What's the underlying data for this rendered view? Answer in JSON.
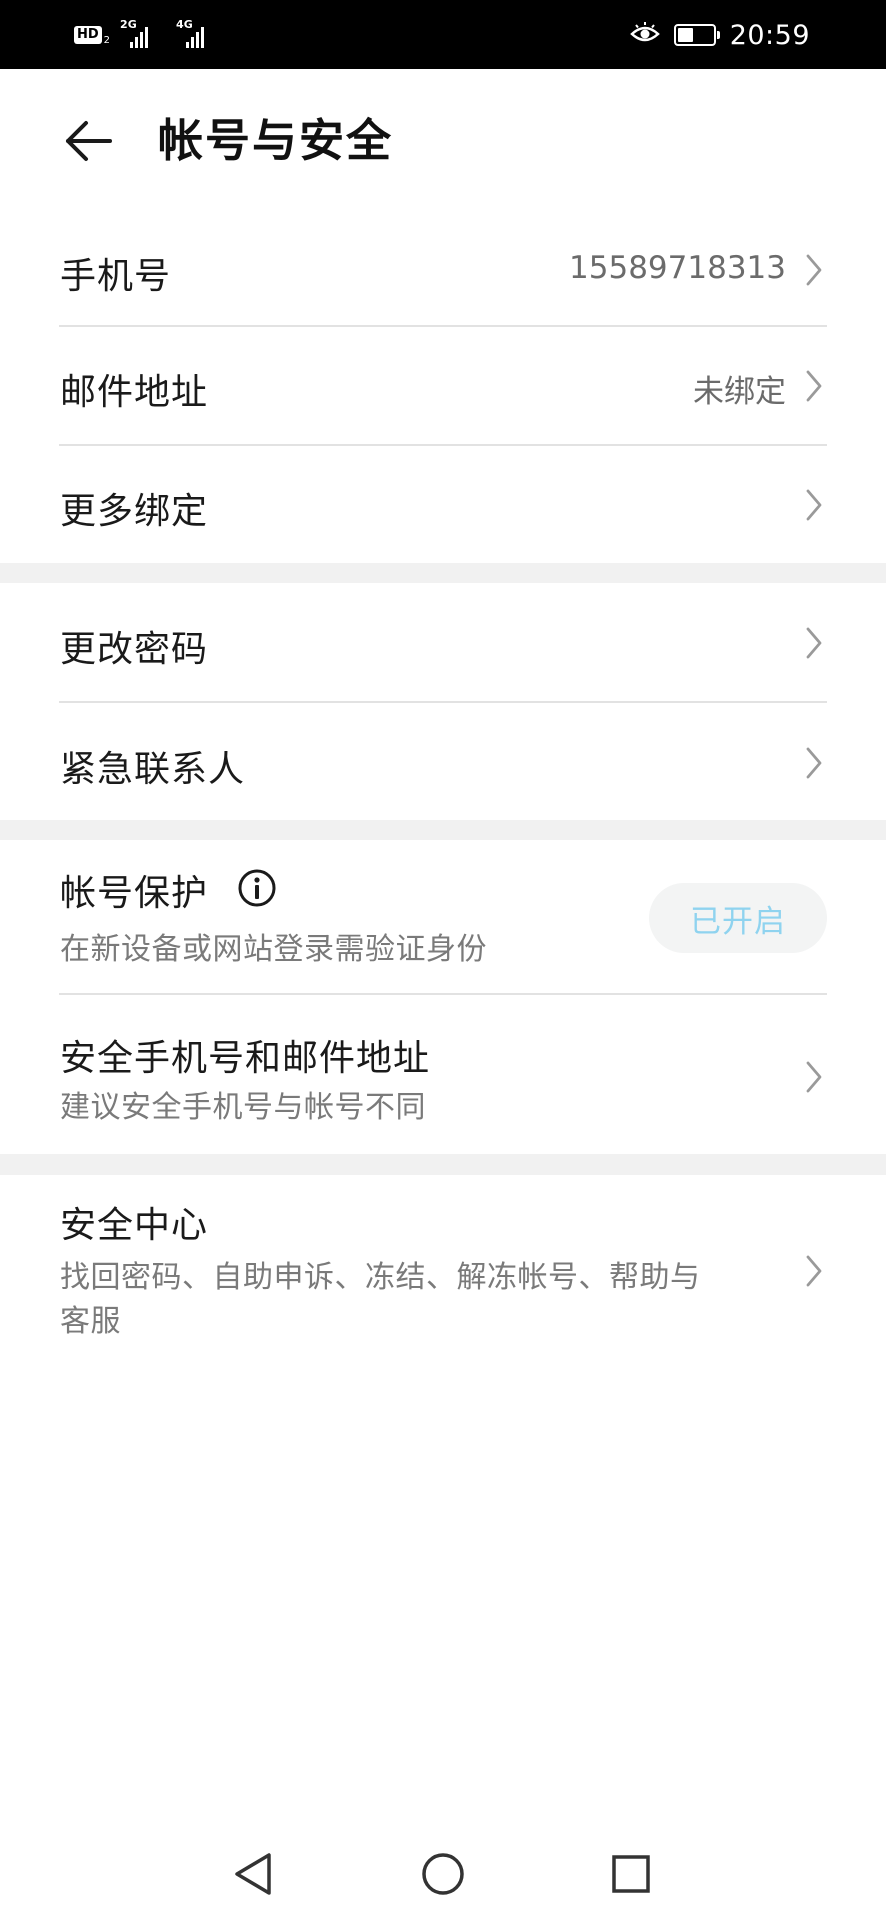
{
  "status_bar": {
    "hd_label": "HD",
    "hd_sub": "2",
    "network_1": "2G",
    "network_2": "4G",
    "time": "20:59",
    "battery_level": 0.45,
    "icons": [
      "eye-comfort-icon",
      "battery-icon",
      "signal-icon"
    ]
  },
  "header": {
    "title": "帐号与安全",
    "back_icon": "arrow-left-icon"
  },
  "group1": {
    "phone": {
      "label": "手机号",
      "value": "15589718313"
    },
    "email": {
      "label": "邮件地址",
      "value": "未绑定"
    },
    "more_bind": {
      "label": "更多绑定"
    }
  },
  "group2": {
    "change_password": {
      "label": "更改密码"
    },
    "emergency_contact": {
      "label": "紧急联系人"
    }
  },
  "group3": {
    "account_protection": {
      "label": "帐号保护",
      "desc": "在新设备或网站登录需验证身份",
      "status": "已开启"
    },
    "security_phone_email": {
      "label": "安全手机号和邮件地址",
      "desc": "建议安全手机号与帐号不同"
    }
  },
  "group4": {
    "security_center": {
      "label": "安全中心",
      "desc_line1": "找回密码、自助申诉、冻结、解冻帐号、帮助与",
      "desc_line2": "客服"
    }
  },
  "colors": {
    "status_bar_bg": "#000000",
    "section_gap": "#f1f1f1",
    "enabled_text": "#8fd3ef",
    "secondary_text": "#7a7a7a"
  },
  "navigation_bar": {
    "back": "triangle-back-icon",
    "home": "circle-home-icon",
    "recents": "square-recents-icon"
  }
}
